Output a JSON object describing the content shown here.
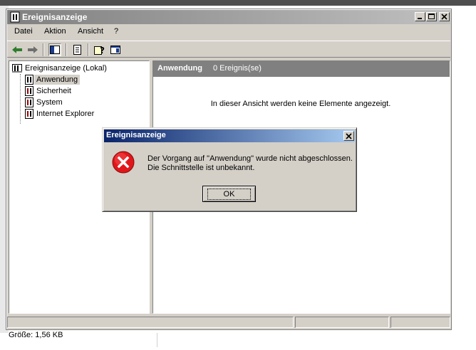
{
  "window": {
    "title": "Ereignisanzeige",
    "menu": [
      "Datei",
      "Aktion",
      "Ansicht",
      "?"
    ]
  },
  "tree": {
    "root": "Ereignisanzeige (Lokal)",
    "items": [
      "Anwendung",
      "Sicherheit",
      "System",
      "Internet Explorer"
    ],
    "selected": "Anwendung"
  },
  "pane": {
    "title": "Anwendung",
    "count": "0 Ereignis(se)",
    "empty_message": "In dieser Ansicht werden keine Elemente angezeigt."
  },
  "dialog": {
    "title": "Ereignisanzeige",
    "line1": "Der Vorgang auf \"Anwendung\" wurde nicht abgeschlossen.",
    "line2": "Die Schnittstelle ist unbekannt.",
    "ok_label": "OK"
  },
  "background": {
    "size_label": "Größe: 1,56 KB"
  },
  "icons": {
    "title": "event-viewer-icon",
    "error": "error-icon",
    "log": "event-log-icon"
  },
  "colors": {
    "dialog_title_start": "#0a246a",
    "dialog_title_end": "#a6caf0",
    "error_red": "#e0161b",
    "pane_header": "#808080"
  }
}
